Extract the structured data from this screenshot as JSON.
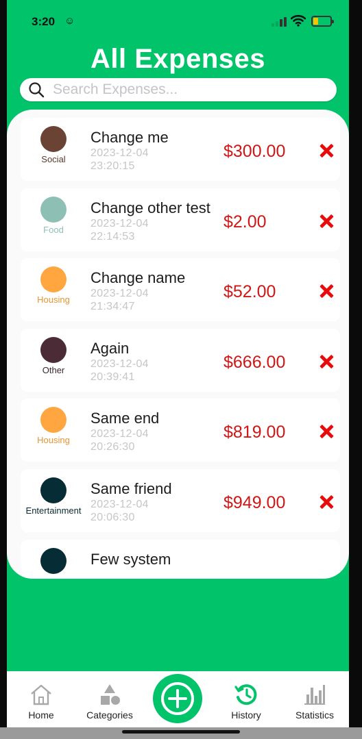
{
  "status_bar": {
    "time": "3:20",
    "face_icon": "smiley-face-icon",
    "signal_icon": "cellular-signal-icon",
    "wifi_icon": "wifi-icon",
    "battery_icon": "battery-icon",
    "battery_level": 0.25
  },
  "page": {
    "title": "All Expenses"
  },
  "search": {
    "placeholder": "Search Expenses...",
    "value": "",
    "icon": "search-icon"
  },
  "colors": {
    "brand_green": "#00c36a",
    "amount_red": "#d11616",
    "delete_red": "#e60c0c"
  },
  "expenses": [
    {
      "name": "Change me",
      "date": "2023-12-04",
      "time": "23:20:15",
      "amount": "$300.00",
      "category": "Social",
      "category_color": "#6a4334",
      "category_text_color": "#5a3a2e"
    },
    {
      "name": "Change other test",
      "date": "2023-12-04",
      "time": "22:14:53",
      "amount": "$2.00",
      "category": "Food",
      "category_color": "#8ebfb5",
      "category_text_color": "#8ebfb5"
    },
    {
      "name": "Change name",
      "date": "2023-12-04",
      "time": "21:34:47",
      "amount": "$52.00",
      "category": "Housing",
      "category_color": "#ffa640",
      "category_text_color": "#e89433"
    },
    {
      "name": "Again",
      "date": "2023-12-04",
      "time": "20:39:41",
      "amount": "$666.00",
      "category": "Other",
      "category_color": "#4b2b36",
      "category_text_color": "#3a2530"
    },
    {
      "name": "Same end",
      "date": "2023-12-04",
      "time": "20:26:30",
      "amount": "$819.00",
      "category": "Housing",
      "category_color": "#ffa640",
      "category_text_color": "#e89433"
    },
    {
      "name": "Same friend",
      "date": "2023-12-04",
      "time": "20:06:30",
      "amount": "$949.00",
      "category": "Entertainment",
      "category_color": "#062c36",
      "category_text_color": "#0b2a33"
    },
    {
      "name": "Few system",
      "date": "",
      "time": "",
      "amount": "",
      "category": "",
      "category_color": "#062c36",
      "category_text_color": "#0b2a33"
    }
  ],
  "tabbar": {
    "items": [
      {
        "label": "Home",
        "icon": "home-icon"
      },
      {
        "label": "Categories",
        "icon": "categories-shapes-icon"
      },
      {
        "label": "History",
        "icon": "history-clock-icon"
      },
      {
        "label": "Statistics",
        "icon": "bar-chart-icon"
      }
    ],
    "add_icon": "add-circle-icon"
  }
}
